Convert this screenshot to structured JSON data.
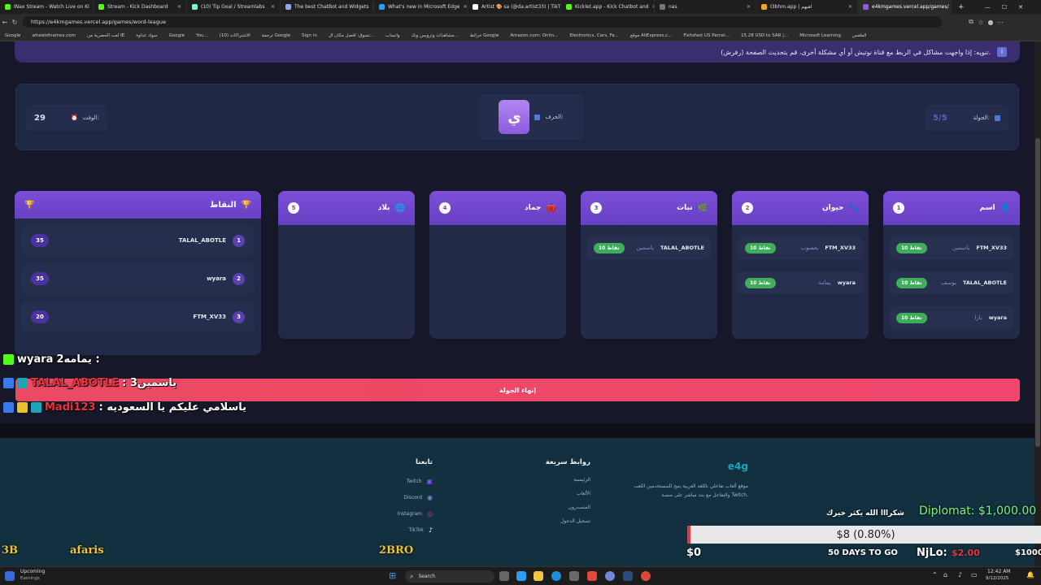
{
  "browser": {
    "tabs": [
      {
        "label": "INax Stream - Watch Live on Ki",
        "color": "#53fc18"
      },
      {
        "label": "Stream - Kick Dashboard",
        "color": "#53fc18"
      },
      {
        "label": "(10) Tip Goal / Streamlabs",
        "color": "#80f5d2"
      },
      {
        "label": "The best ChatBot and Widgets",
        "color": "#9aa0ff"
      },
      {
        "label": "What's new in Microsoft Edge",
        "color": "#2a9df4"
      },
      {
        "label": "Artist 🎨 sa (@da.artist33) | TikT",
        "color": "#ffffff"
      },
      {
        "label": "Kicklet.app - Kick Chatbot and",
        "color": "#53fc18"
      },
      {
        "label": "nas",
        "color": "#777777"
      },
      {
        "label": "I3bhm.app | لعبهم",
        "color": "#f5a623"
      },
      {
        "label": "e4kmgames.vercel.app/games/",
        "color": "#8f5ae0"
      }
    ],
    "url": "https://e4kmgames.vercel.app/games/word-league",
    "bookmarks": [
      "Google",
      "wheelofnames.com",
      "لعب الحضرية من IE",
      "سواد عداوة",
      "Google",
      "You...",
      "(10) الاشتراكات",
      "ترجمة Google",
      "Sign in",
      "تسوق: افضل مكان ال...",
      "واتساب",
      "مشاهدات وترويس ونك...",
      "خرائط Google",
      "Amazon.com: Onlin...",
      "Electronics, Cars, Fa...",
      "موقع AliExpress.c...",
      "Fishsfast US Parcel...",
      "15.28 USD to SAR |...",
      "Microsoft Learning",
      "الطقس"
    ]
  },
  "notice": {
    "text": "تنويه: إذا واجهت مشاكل في الربط مع قناة نوتيش أو أي مشكلة أخرى، قم بتحديث الصفحة (رفرش).",
    "icon": "info-icon"
  },
  "status": {
    "round_label": "الجولة:",
    "round_value": "5/5",
    "letter_label": "الحرف:",
    "letter_value": "ي",
    "time_label": "الوقت:",
    "time_value": "29"
  },
  "columns": [
    {
      "num": "1",
      "title": "اسم",
      "icon": "person-icon",
      "entries": [
        {
          "player": "FTM_XV33",
          "answer": "ياسمين",
          "points": "10 نقاط"
        },
        {
          "player": "TALAL_ABOTLE",
          "answer": "يوسف",
          "points": "10 نقاط"
        },
        {
          "player": "wyara",
          "answer": "يارا",
          "points": "10 نقاط"
        }
      ]
    },
    {
      "num": "2",
      "title": "حيوان",
      "icon": "animal-icon",
      "entries": [
        {
          "player": "FTM_XV33",
          "answer": "يعسوب",
          "points": "10 نقاط"
        },
        {
          "player": "wyara",
          "answer": "يمامة",
          "points": "10 نقاط"
        }
      ]
    },
    {
      "num": "3",
      "title": "نبات",
      "icon": "plant-icon",
      "entries": [
        {
          "player": "TALAL_ABOTLE",
          "answer": "ياسمين",
          "points": "10 نقاط"
        }
      ]
    },
    {
      "num": "4",
      "title": "جماد",
      "icon": "box-icon",
      "entries": []
    },
    {
      "num": "5",
      "title": "بلاد",
      "icon": "globe-icon",
      "entries": []
    }
  ],
  "points_panel": {
    "title": "النقاط",
    "rows": [
      {
        "rank": "1",
        "player": "TALAL_ABOTLE",
        "score": "35"
      },
      {
        "rank": "2",
        "player": "wyara",
        "score": "35"
      },
      {
        "rank": "3",
        "player": "FTM_XV33",
        "score": "20"
      }
    ]
  },
  "end_round_label": "إنهاء الجولة",
  "footer": {
    "brand": "e4g",
    "description": "موقع ألعاب تفاعلي باللغة العربية يتيح للمستخدمين اللعب والتفاعل مع بث مباشر على منصة Twitch.",
    "quick_links_title": "روابط سريعة",
    "quick_links": [
      "الرئيسية",
      "الألعاب",
      "المتصدرون",
      "تسجيل الدخول"
    ],
    "follow_title": "تابعنا",
    "follow_links": [
      "Twitch",
      "Discord",
      "Instagram",
      "TikTok"
    ]
  },
  "overlay": {
    "chat": [
      {
        "user": "wyara",
        "message": "يمامه2 :",
        "user_color": "#ffffff"
      },
      {
        "user": "TALAL_ABOTLE",
        "message": ": ياسمين3",
        "user_color": "#e8343e"
      },
      {
        "user": "Madi123",
        "message": ": ياسلامي عليكم يا السعوديه",
        "user_color": "#e8343e"
      }
    ],
    "thanks": "شكرااا الله يكثر خيرك",
    "diplomat": "Diplomat: $1,000.00",
    "donation_bar": "$8 (0.80%)",
    "goal_start": "$0",
    "days_to_go": "50 DAYS TO GO",
    "njlo_label": "NjLo:",
    "njlo_amount": "$2.00",
    "goal_end": "$1000",
    "ticker_left": "3B",
    "ticker_mid": "afaris",
    "ticker_right": "2BRO"
  },
  "taskbar": {
    "weather_title": "Upcoming",
    "weather_sub": "Earnings",
    "search": "Search",
    "time": "12:42 AM",
    "date": "9/12/2025"
  }
}
